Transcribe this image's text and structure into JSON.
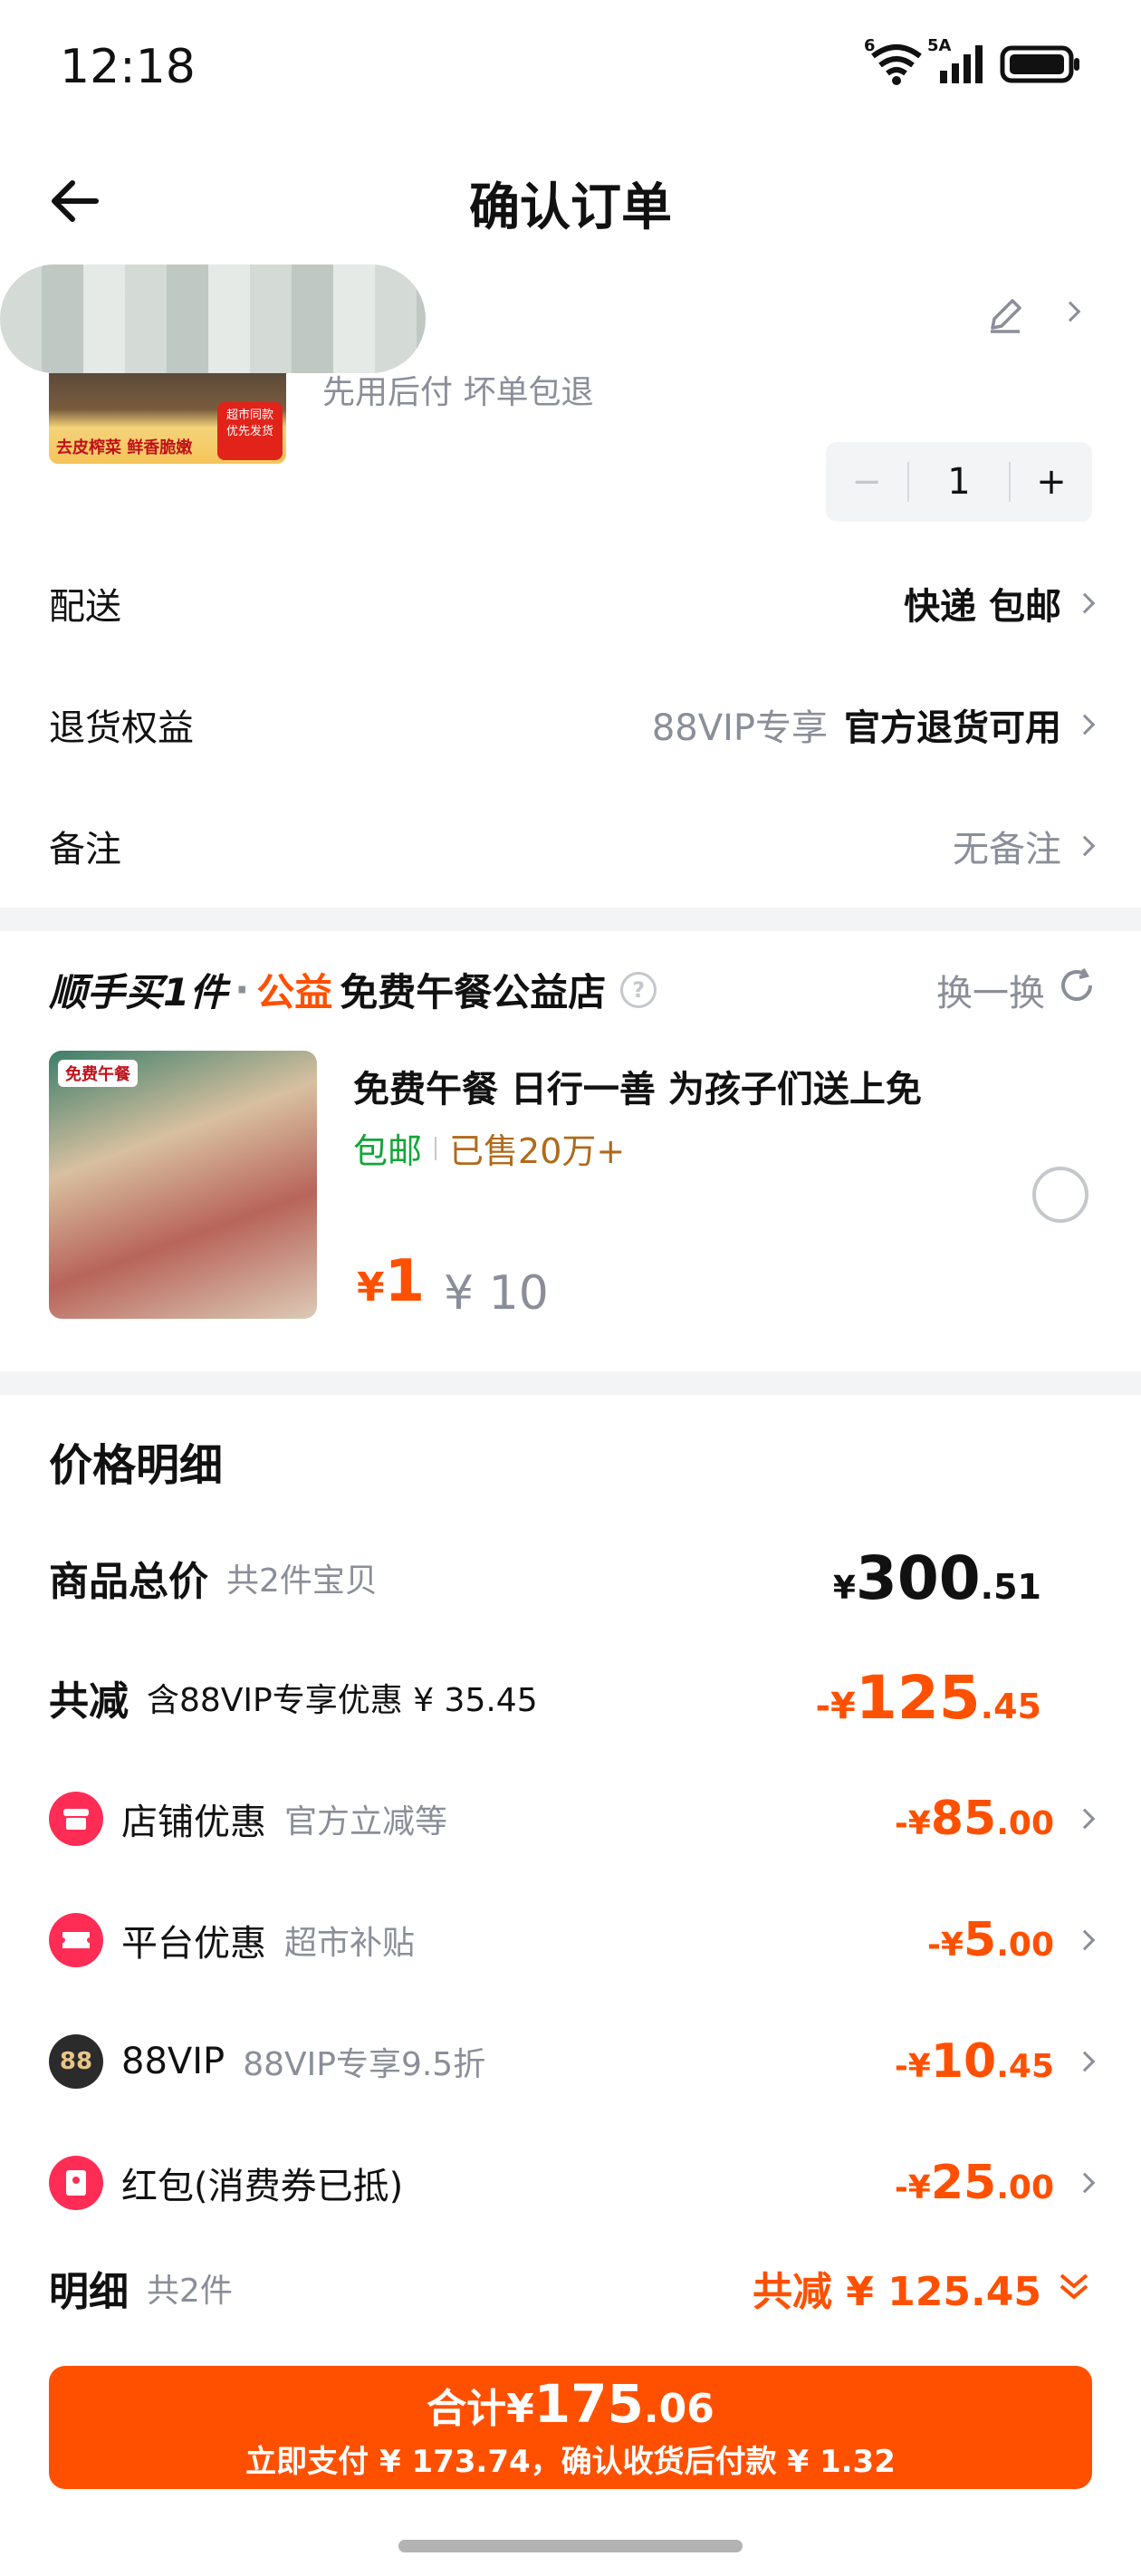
{
  "status_bar": {
    "time": "12:18",
    "network_label_1": "6",
    "network_label_2": "5A"
  },
  "header": {
    "title": "确认订单"
  },
  "product": {
    "img_tag": "去皮榨菜 鲜香脆嫩",
    "img_badge_1": "超市同款",
    "img_badge_2": "优先发货",
    "tags": "先用后付  坏单包退",
    "quantity": "1",
    "minus": "−",
    "plus": "+"
  },
  "rows": {
    "delivery": {
      "label": "配送",
      "value": "快递 包邮"
    },
    "returns": {
      "label": "退货权益",
      "prefix": "88VIP专享",
      "value": "官方退货可用"
    },
    "note": {
      "label": "备注",
      "value": "无备注"
    }
  },
  "recommend": {
    "head_main": "顺手买1件",
    "head_dot": "·",
    "head_tag": "公益",
    "head_store": "免费午餐公益店",
    "switch_label": "换一换",
    "img_logo": "免费午餐",
    "title": "免费午餐 日行一善 为孩子们送上免",
    "free_ship": "包邮",
    "sold": "已售20万+",
    "price_symbol": "¥",
    "price": "1",
    "orig_price": "¥ 10"
  },
  "price_details": {
    "title": "价格明细",
    "total": {
      "label": "商品总价",
      "sub": "共2件宝贝",
      "sym": "¥",
      "int": "300",
      "dec": ".51"
    },
    "reduce": {
      "label": "共减",
      "sub": "含88VIP专享优惠 ¥ 35.45",
      "sym": "-¥",
      "int": "125",
      "dec": ".45"
    },
    "items": [
      {
        "label": "店铺优惠",
        "sub": "官方立减等",
        "sym": "-¥",
        "int": "85",
        "dec": ".00",
        "icon": "store-icon",
        "color": "#ff2d55"
      },
      {
        "label": "平台优惠",
        "sub": "超市补贴",
        "sym": "-¥",
        "int": "5",
        "dec": ".00",
        "icon": "ticket-icon",
        "color": "#ff2d55"
      },
      {
        "label": "88VIP",
        "sub": "88VIP专享9.5折",
        "sym": "-¥",
        "int": "10",
        "dec": ".45",
        "icon": "vip88-icon",
        "color": "#2b2b2b",
        "icon_text": "88"
      },
      {
        "label": "红包(消费券已抵)",
        "sub": "",
        "sym": "-¥",
        "int": "25",
        "dec": ".00",
        "icon": "red-envelope-icon",
        "color": "#ff2d55"
      }
    ],
    "detail": {
      "label": "明细",
      "sub": "共2件",
      "summary": "共减 ¥ 125.45"
    }
  },
  "footer": {
    "total_label": "合计¥",
    "total_int": "175",
    "total_dec": ".06",
    "sub": "立即支付 ¥ 173.74，确认收货后付款 ¥ 1.32"
  },
  "colors": {
    "accent": "#ff5000",
    "muted": "#8a8e99",
    "separator": "#f3f4f6"
  }
}
